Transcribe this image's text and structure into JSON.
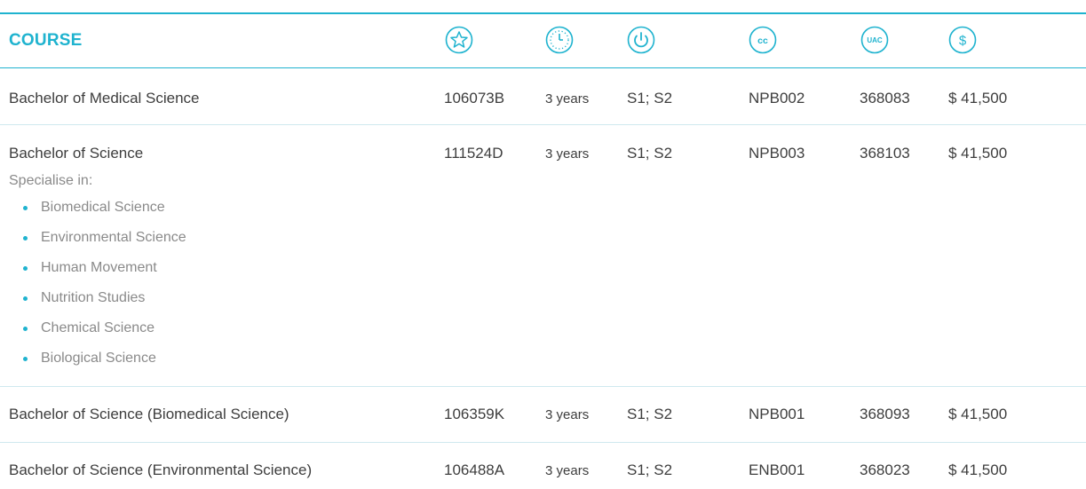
{
  "header": {
    "course_label": "COURSE",
    "icons": [
      {
        "name": "star-icon",
        "text": ""
      },
      {
        "name": "clock-icon",
        "text": ""
      },
      {
        "name": "power-icon",
        "text": ""
      },
      {
        "name": "cc-icon",
        "text": "cc"
      },
      {
        "name": "uac-icon",
        "text": "UAC"
      },
      {
        "name": "dollar-icon",
        "text": "$"
      }
    ],
    "accent_color": "#1fb3cf"
  },
  "courses": [
    {
      "title": "Bachelor of Medical Science",
      "code": "106073B",
      "duration": "3 years",
      "semesters": "S1; S2",
      "cc": "NPB002",
      "uac": "368083",
      "fee": "$ 41,500"
    },
    {
      "title": "Bachelor of Science",
      "code": "111524D",
      "duration": "3 years",
      "semesters": "S1; S2",
      "cc": "NPB003",
      "uac": "368103",
      "fee": "$ 41,500",
      "specialise_label": "Specialise in:",
      "specialisations": [
        "Biomedical Science",
        "Environmental Science",
        "Human Movement",
        "Nutrition Studies",
        "Chemical Science",
        "Biological Science"
      ]
    },
    {
      "title": "Bachelor of Science (Biomedical Science)",
      "code": "106359K",
      "duration": "3 years",
      "semesters": "S1; S2",
      "cc": "NPB001",
      "uac": "368093",
      "fee": "$ 41,500"
    },
    {
      "title": "Bachelor of Science (Environmental Science)",
      "code": "106488A",
      "duration": "3 years",
      "semesters": "S1; S2",
      "cc": "ENB001",
      "uac": "368023",
      "fee": "$ 41,500"
    }
  ]
}
